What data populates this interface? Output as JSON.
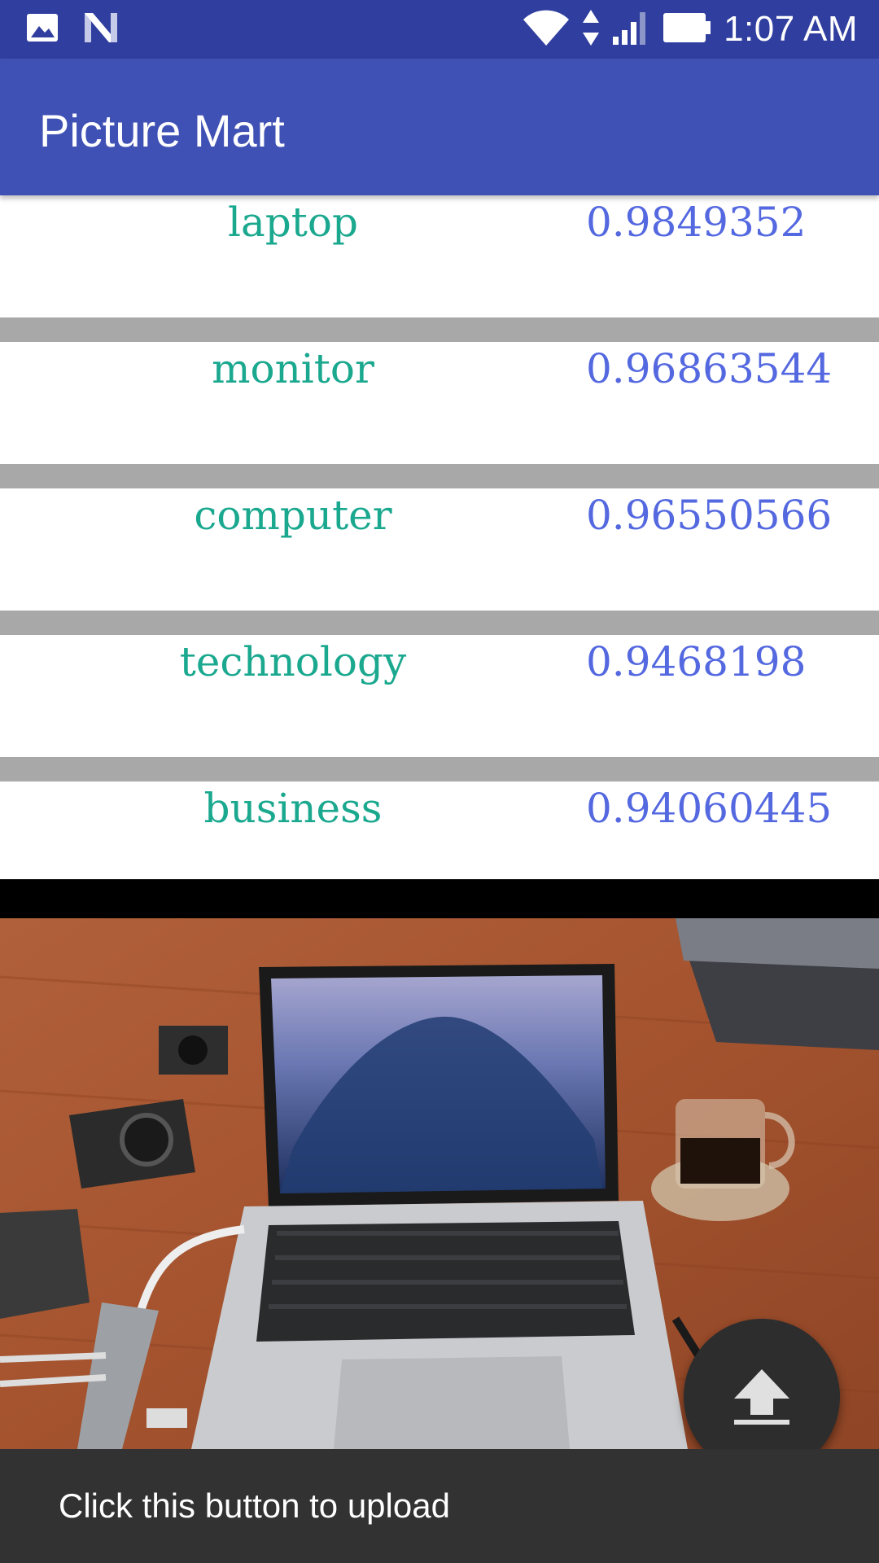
{
  "status_bar": {
    "time": "1:07 AM",
    "left_icons": [
      "image-icon",
      "notification-n-icon"
    ],
    "right_icons": [
      "wifi-icon",
      "data-arrows-icon",
      "signal-icon",
      "battery-icon"
    ]
  },
  "app_bar": {
    "title": "Picture Mart",
    "color": "#3f51b5"
  },
  "results": [
    {
      "label": "laptop",
      "score": "0.9849352"
    },
    {
      "label": "monitor",
      "score": "0.96863544"
    },
    {
      "label": "computer",
      "score": "0.96550566"
    },
    {
      "label": "technology",
      "score": "0.9468198"
    },
    {
      "label": "business",
      "score": "0.94060445"
    }
  ],
  "photo": {
    "subject": "laptop-desk-photo"
  },
  "fab": {
    "icon": "upload-icon"
  },
  "snackbar": {
    "message": "Click this button to upload"
  },
  "colors": {
    "label": "#1aa88f",
    "score": "#5468e0",
    "status_bar": "#303f9f",
    "snackbar": "#323232"
  }
}
